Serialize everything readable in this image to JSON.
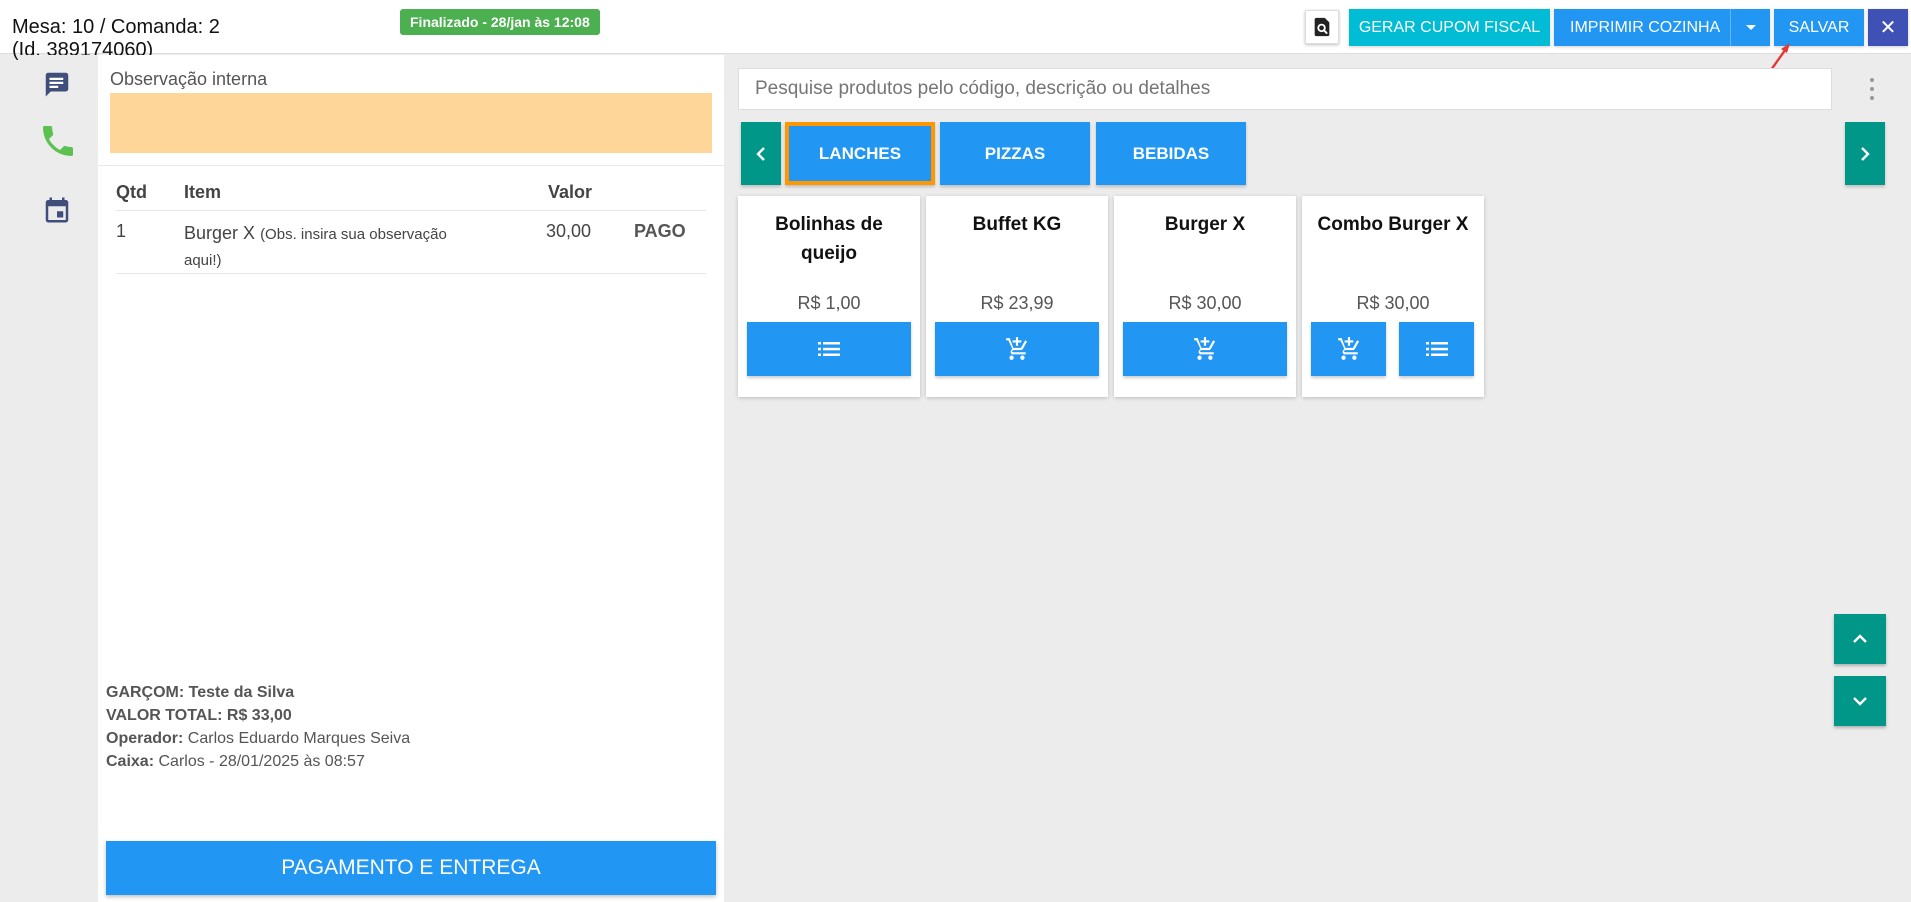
{
  "header": {
    "title_line1": "Mesa: 10 / Comanda: 2",
    "title_line2": "(Id. 389174060)",
    "status": "Finalizado - 28/jan às 12:08",
    "buttons": {
      "gerar_cupom": "GERAR CUPOM FISCAL",
      "imprimir_cozinha": "IMPRIMIR COZINHA",
      "salvar": "SALVAR",
      "close": "✕"
    }
  },
  "sidebar": {
    "icons": [
      "message-icon",
      "phone-icon",
      "calendar-icon"
    ]
  },
  "order": {
    "obs_label": "Observação interna",
    "columns": {
      "qtd": "Qtd",
      "item": "Item",
      "valor": "Valor"
    },
    "rows": [
      {
        "qtd": "1",
        "item": "Burger X",
        "obs": "(Obs. insira sua observação aqui!)",
        "valor": "30,00",
        "status": "PAGO"
      }
    ],
    "summary": {
      "garcom_label": "GARÇOM:",
      "garcom": "Teste da Silva",
      "total_label": "VALOR TOTAL:",
      "total": "R$ 33,00",
      "operador_label": "Operador:",
      "operador": "Carlos Eduardo Marques Seiva",
      "caixa_label": "Caixa:",
      "caixa": "Carlos - 28/01/2025 às 08:57"
    },
    "pay_button": "PAGAMENTO E ENTREGA"
  },
  "catalog": {
    "search_placeholder": "Pesquise produtos pelo código, descrição ou detalhes",
    "categories": [
      "LANCHES",
      "PIZZAS",
      "BEBIDAS"
    ],
    "active_category": "LANCHES",
    "products": [
      {
        "name": "Bolinhas de queijo",
        "price": "R$ 1,00"
      },
      {
        "name": "Buffet KG",
        "price": "R$ 23,99"
      },
      {
        "name": "Burger X",
        "price": "R$ 30,00"
      },
      {
        "name": "Combo Burger X",
        "price": "R$ 30,00"
      }
    ]
  },
  "colors": {
    "primary": "#2196f3",
    "teal": "#009688",
    "cyan": "#00bcd4",
    "indigo": "#3f51b5",
    "success": "#4caf50",
    "active_border": "#ff9800",
    "obs_bg": "#ffd699"
  }
}
